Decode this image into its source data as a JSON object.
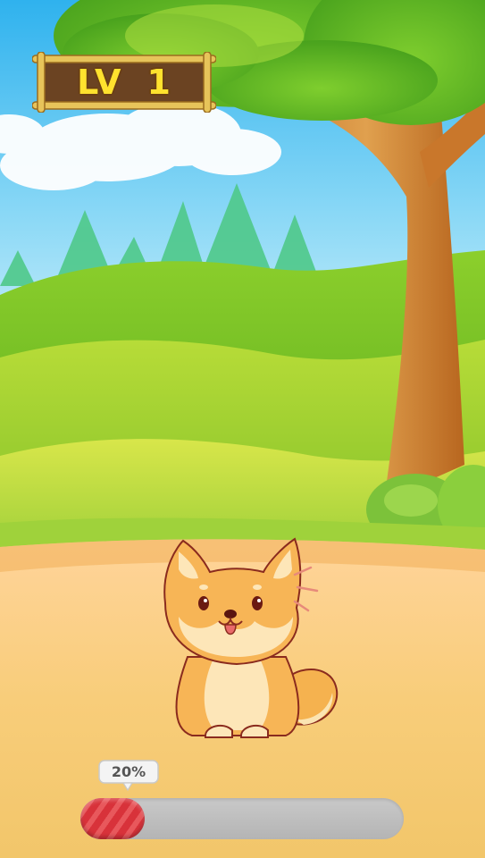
{
  "level": {
    "prefix": "LV",
    "number": "1"
  },
  "progress": {
    "percent_label": "20%",
    "fraction": 0.2
  },
  "pet": {
    "kind": "shiba-dog"
  },
  "colors": {
    "sky": "#4fc3f0",
    "grass": "#7cc23a",
    "ground": "#f4c873",
    "fill": "#d8323a"
  }
}
